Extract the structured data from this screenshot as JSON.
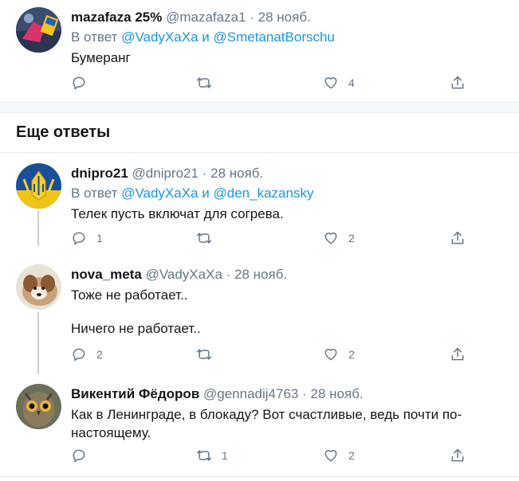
{
  "top_tweet": {
    "name": "mazafaza 25%",
    "handle": "@mazafaza1",
    "sep": "·",
    "date": "28 нояб.",
    "reply_prefix": "В ответ",
    "reply_user1": "@VadyXaXa",
    "reply_and": "и",
    "reply_user2": "@SmetanatBorschu",
    "text": "Бумеранг",
    "replies": "",
    "retweets": "",
    "likes": "4"
  },
  "section": {
    "title": "Еще ответы"
  },
  "replies": [
    {
      "name": "dnipro21",
      "handle": "@dnipro21",
      "sep": "·",
      "date": "28 нояб.",
      "reply_prefix": "В ответ",
      "reply_user1": "@VadyXaXa",
      "reply_and": "и",
      "reply_user2": "@den_kazansky",
      "text": "Телек пусть включат для согрева.",
      "replies": "1",
      "retweets": "",
      "likes": "2"
    },
    {
      "name": "nova_meta",
      "handle": "@VadyXaXa",
      "sep": "·",
      "date": "28 нояб.",
      "text_line1": "Тоже не работает..",
      "text_line2": "Ничего не работает..",
      "replies": "2",
      "retweets": "",
      "likes": "2"
    },
    {
      "name": "Викентий Фёдоров",
      "handle": "@gennadij4763",
      "sep": "·",
      "date": "28 нояб.",
      "text_line1": "Как в Ленинграде, в блокаду? Вот счастливые, ведь почти по-",
      "text_line2": "настоящему.",
      "replies": "",
      "retweets": "1",
      "likes": "2"
    }
  ],
  "icons": {
    "reply": "reply-icon",
    "retweet": "retweet-icon",
    "like": "heart-icon",
    "share": "share-icon"
  },
  "colors": {
    "link": "#1b95e0",
    "secondary": "#657786",
    "primary_text": "#14171a"
  }
}
